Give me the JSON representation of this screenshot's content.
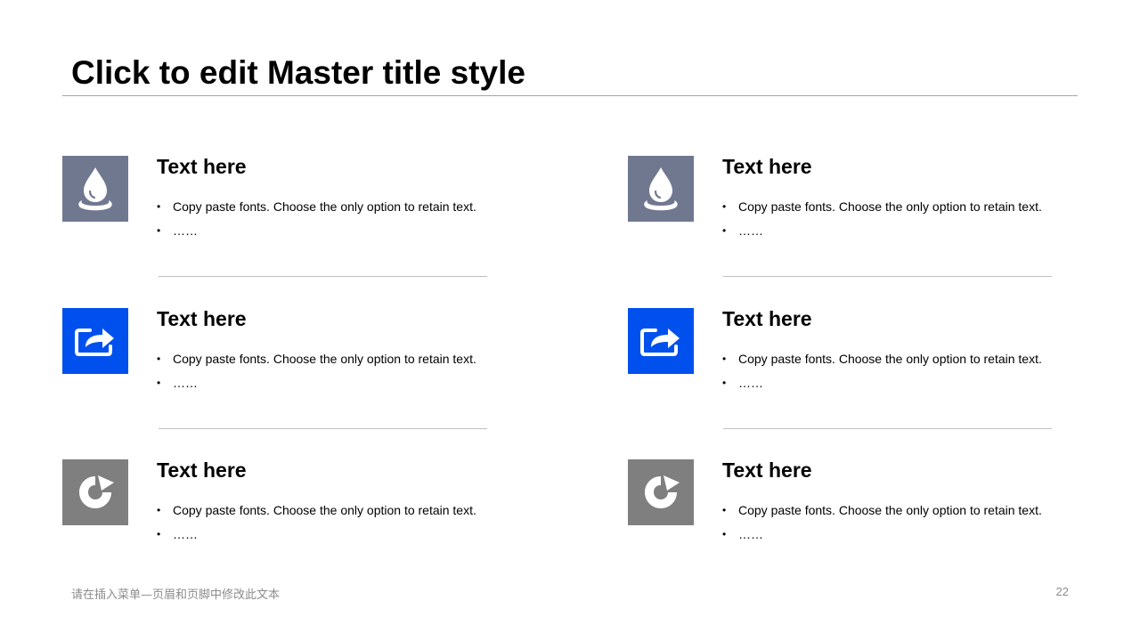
{
  "slide": {
    "title": "Click to edit Master title style",
    "footer_text": "请在插入菜单—页眉和页脚中修改此文本",
    "page_number": "22"
  },
  "colors": {
    "icon_drop_bg": "#707890",
    "icon_share_bg": "#0050ee",
    "icon_refresh_bg": "#7f7f7f",
    "divider": "#bfbfbf"
  },
  "columns": [
    {
      "items": [
        {
          "icon": "water-drop-icon",
          "heading": "Text here",
          "bullets": [
            "Copy paste fonts. Choose the only option to retain text.",
            "……"
          ]
        },
        {
          "icon": "share-icon",
          "heading": "Text here",
          "bullets": [
            "Copy paste fonts. Choose the only option to retain text.",
            "……"
          ]
        },
        {
          "icon": "refresh-icon",
          "heading": "Text here",
          "bullets": [
            "Copy paste fonts. Choose the only option to retain text.",
            "……"
          ]
        }
      ]
    },
    {
      "items": [
        {
          "icon": "water-drop-icon",
          "heading": "Text here",
          "bullets": [
            "Copy paste fonts. Choose the only option to retain text.",
            "……"
          ]
        },
        {
          "icon": "share-icon",
          "heading": "Text here",
          "bullets": [
            "Copy paste fonts. Choose the only option to retain text.",
            "……"
          ]
        },
        {
          "icon": "refresh-icon",
          "heading": "Text here",
          "bullets": [
            "Copy paste fonts. Choose the only option to retain text.",
            "……"
          ]
        }
      ]
    }
  ]
}
